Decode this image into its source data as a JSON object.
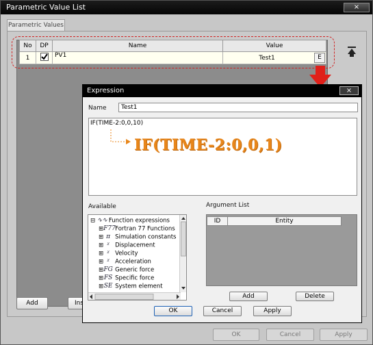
{
  "window": {
    "title": "Parametric Value List",
    "close_icon": "×"
  },
  "tab": {
    "label": "Parametric Values"
  },
  "table": {
    "columns": [
      "No",
      "DP",
      "Name",
      "Value"
    ],
    "rows": [
      {
        "no": "1",
        "dp_checked": true,
        "name": "PV1",
        "value": "Test1",
        "edit_label": "E"
      }
    ]
  },
  "bottom_buttons": {
    "add": "Add",
    "insert": "Ins",
    "ok": "OK",
    "cancel": "Cancel",
    "apply": "Apply"
  },
  "colors": {
    "highlight_red": "#d12020",
    "annotation_orange": "#e8861a"
  },
  "dialog": {
    "title": "Expression",
    "close_icon": "×",
    "name_label": "Name",
    "name_value": "Test1",
    "expression_text": "IF(TIME-2:0,0,10)",
    "annotation": "IF(TIME-2:0,0,1)",
    "available_label": "Available",
    "tree": [
      {
        "expander": "⊟",
        "icon": "∿∿",
        "label": "Function expressions"
      },
      {
        "expander": "⊞",
        "icon": "F77",
        "label": "Fortran 77 Functions"
      },
      {
        "expander": "⊞",
        "icon": "π",
        "label": "Simulation constants"
      },
      {
        "expander": "⊞",
        "icon": "ᵡ",
        "label": "Displacement"
      },
      {
        "expander": "⊞",
        "icon": "ᵡ",
        "label": "Velocity"
      },
      {
        "expander": "⊞",
        "icon": "ᵡ",
        "label": "Acceleration"
      },
      {
        "expander": "⊞",
        "icon": "FG",
        "label": "Generic force"
      },
      {
        "expander": "⊞",
        "icon": "FS",
        "label": "Specific force"
      },
      {
        "expander": "⊞",
        "icon": "SE",
        "label": "System element"
      }
    ],
    "argument_list_label": "Argument List",
    "arg_columns": [
      "ID",
      "Entity"
    ],
    "arg_add": "Add",
    "arg_delete": "Delete",
    "ok": "OK",
    "cancel": "Cancel",
    "apply": "Apply"
  }
}
